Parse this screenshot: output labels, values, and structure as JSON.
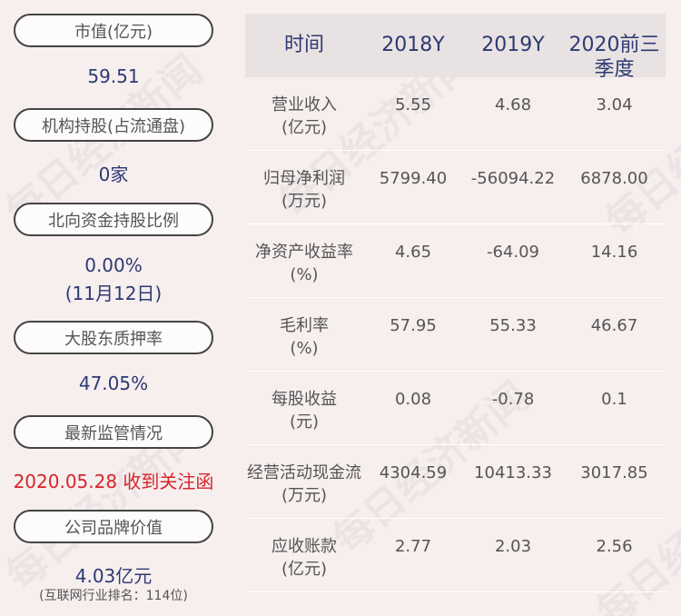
{
  "left": {
    "market_cap_label": "市值(亿元)",
    "market_cap_value": "59.51",
    "inst_holding_label": "机构持股(占流通盘)",
    "inst_holding_value": "0家",
    "northbound_label": "北向资金持股比例",
    "northbound_value": "0.00%",
    "northbound_date": "(11月12日)",
    "pledge_label": "大股东质押率",
    "pledge_value": "47.05%",
    "regulation_label": "最新监管情况",
    "regulation_value": "2020.05.28 收到关注函",
    "brand_label": "公司品牌价值",
    "brand_value": "4.03亿元",
    "brand_rank": "(互联网行业排名：114位)"
  },
  "table": {
    "headers": [
      "时间",
      "2018Y",
      "2019Y",
      "2020前三季度"
    ],
    "rows": [
      {
        "label": "营业收入",
        "unit": "(亿元)",
        "v2018": "5.55",
        "v2019": "4.68",
        "v2020": "3.04"
      },
      {
        "label": "归母净利润",
        "unit": "(万元)",
        "v2018": "5799.40",
        "v2019": "-56094.22",
        "v2020": "6878.00"
      },
      {
        "label": "净资产收益率",
        "unit": "(%)",
        "v2018": "4.65",
        "v2019": "-64.09",
        "v2020": "14.16"
      },
      {
        "label": "毛利率",
        "unit": "(%)",
        "v2018": "57.95",
        "v2019": "55.33",
        "v2020": "46.67"
      },
      {
        "label": "每股收益",
        "unit": "(元)",
        "v2018": "0.08",
        "v2019": "-0.78",
        "v2020": "0.1"
      },
      {
        "label": "经营活动现金流",
        "unit": "(万元)",
        "v2018": "4304.59",
        "v2019": "10413.33",
        "v2020": "3017.85"
      },
      {
        "label": "应收账款",
        "unit": "(亿元)",
        "v2018": "2.77",
        "v2019": "2.03",
        "v2020": "2.56"
      }
    ]
  },
  "watermark_text": "每日经济新闻"
}
